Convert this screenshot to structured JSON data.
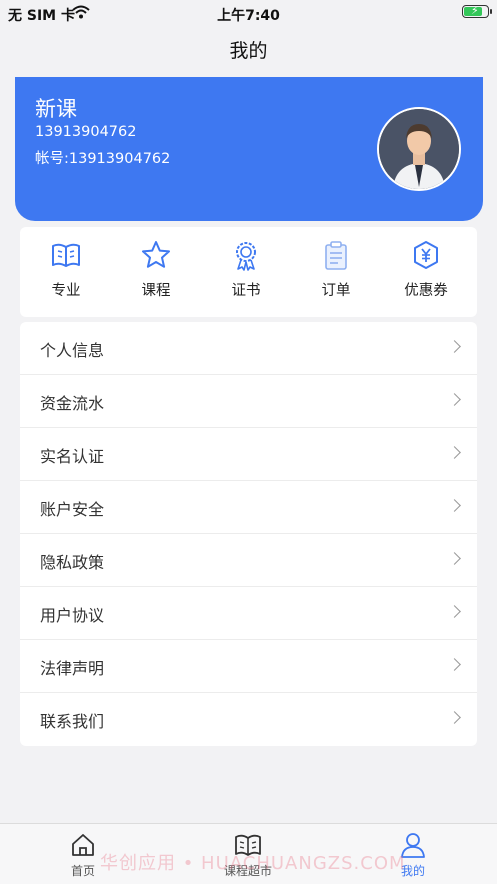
{
  "status_bar": {
    "carrier": "无 SIM 卡",
    "time": "上午7:40",
    "battery_level": 0.85
  },
  "header": {
    "title": "我的"
  },
  "profile": {
    "name": "新课",
    "phone": "13913904762",
    "account": "帐号:13913904762"
  },
  "shortcuts": [
    {
      "label": "专业",
      "icon": "book-icon"
    },
    {
      "label": "课程",
      "icon": "star-icon"
    },
    {
      "label": "证书",
      "icon": "certificate-icon"
    },
    {
      "label": "订单",
      "icon": "clipboard-icon"
    },
    {
      "label": "优惠券",
      "icon": "coupon-icon"
    }
  ],
  "menu": [
    {
      "label": "个人信息"
    },
    {
      "label": "资金流水"
    },
    {
      "label": "实名认证"
    },
    {
      "label": "账户安全"
    },
    {
      "label": "隐私政策"
    },
    {
      "label": "用户协议"
    },
    {
      "label": "法律声明"
    },
    {
      "label": "联系我们"
    }
  ],
  "tabs": [
    {
      "label": "首页",
      "icon": "home-icon"
    },
    {
      "label": "课程超市",
      "icon": "book-icon"
    },
    {
      "label": "我的",
      "icon": "user-icon",
      "active": true
    }
  ],
  "watermark": "华创应用 • HUACHUANGZS.COM",
  "colors": {
    "accent": "#3e78f1",
    "background": "#f2f2f4",
    "watermark": "#e97084"
  }
}
